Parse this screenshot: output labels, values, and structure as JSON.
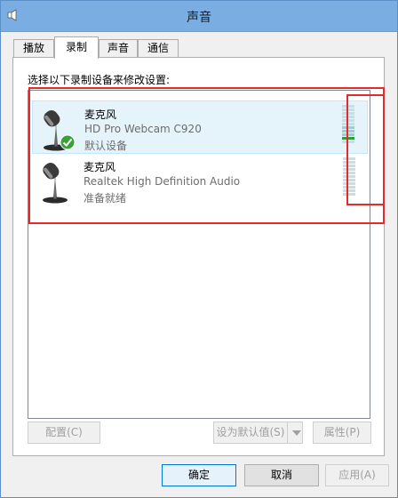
{
  "window": {
    "title": "声音"
  },
  "tabs": [
    {
      "label": "播放",
      "active": false
    },
    {
      "label": "录制",
      "active": true
    },
    {
      "label": "声音",
      "active": false
    },
    {
      "label": "通信",
      "active": false
    }
  ],
  "panel": {
    "instruction": "选择以下录制设备来修改设置:",
    "devices": [
      {
        "name": "麦克风",
        "description": "HD Pro Webcam C920",
        "status": "默认设备",
        "selected": true,
        "is_default": true,
        "level_bars_total": 11,
        "level_bars_active": 1
      },
      {
        "name": "麦克风",
        "description": "Realtek High Definition Audio",
        "status": "准备就绪",
        "selected": false,
        "is_default": false,
        "level_bars_total": 11,
        "level_bars_active": 0
      }
    ],
    "buttons": {
      "configure": "配置(C)",
      "set_default": "设为默认值(S)",
      "properties": "属性(P)"
    }
  },
  "footer": {
    "ok": "确定",
    "cancel": "取消",
    "apply": "应用(A)"
  },
  "colors": {
    "titlebar": "#7aaee2",
    "annotation_red": "#e32b2b",
    "level_green": "#2e9e3a",
    "selected_row": "#e5f3fb"
  }
}
